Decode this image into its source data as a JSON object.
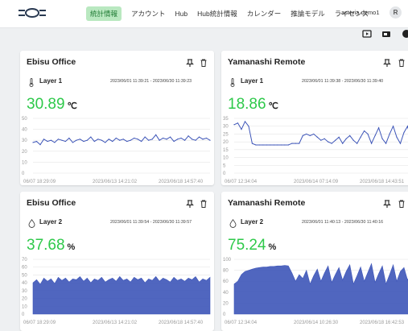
{
  "nav": {
    "items": [
      {
        "label": "統計情報",
        "active": true
      },
      {
        "label": "アカウント",
        "active": false
      },
      {
        "label": "Hub",
        "active": false
      },
      {
        "label": "Hub統計情報",
        "active": false
      },
      {
        "label": "カレンダー",
        "active": false
      },
      {
        "label": "推論モデル",
        "active": false
      },
      {
        "label": "ライセンス",
        "active": false
      }
    ],
    "user_name": "asteria demo1",
    "avatar_initial": "R"
  },
  "toolbar": {
    "icons": [
      "play-icon",
      "window-icon",
      "more-icon"
    ]
  },
  "colors": {
    "accent": "#2ec94a",
    "nav_active_bg": "#b9e8c0",
    "chart_line": "#3d55b8"
  },
  "cards": [
    {
      "title": "Ebisu Office",
      "sensor_icon": "thermometer-icon",
      "layer": "Layer 1",
      "range": "2023/06/01 11:39:21 - 2023/06/30 11:39:23",
      "value": "30.89",
      "unit": "℃",
      "chart_data": {
        "type": "line",
        "y_ticks": [
          "50",
          "40",
          "30",
          "20",
          "10",
          "0"
        ],
        "ylim": [
          0,
          50
        ],
        "x_ticks": [
          "06/07 18:29:09",
          "2023/06/13 14:21:02",
          "2023/06/18 14:57:40"
        ],
        "values": [
          28,
          29,
          26,
          31,
          29,
          30,
          28,
          31,
          30,
          29,
          32,
          28,
          30,
          31,
          29,
          30,
          33,
          29,
          31,
          30,
          28,
          31,
          29,
          32,
          30,
          31,
          29,
          30,
          32,
          31,
          29,
          33,
          30,
          31,
          35,
          30,
          32,
          31,
          33,
          29,
          31,
          32,
          30,
          34,
          31,
          30,
          33,
          31,
          32,
          30
        ]
      }
    },
    {
      "title": "Yamanashi Remote",
      "sensor_icon": "thermometer-icon",
      "layer": "Layer 1",
      "range": "2023/06/01 11:39:38 - 2023/06/30 11:39:40",
      "value": "18.86",
      "unit": "℃",
      "chart_data": {
        "type": "line",
        "y_ticks": [
          "35",
          "30",
          "25",
          "20",
          "15",
          "10",
          "5",
          "0"
        ],
        "ylim": [
          0,
          35
        ],
        "x_ticks": [
          "06/07 12:34:04",
          "2023/06/14 07:14:09",
          "2023/06/18 14:43:51"
        ],
        "values": [
          31,
          32,
          28,
          33,
          30,
          19,
          18,
          18,
          18,
          18,
          18,
          18,
          18,
          18,
          18,
          18,
          19,
          19,
          19,
          24,
          25,
          24,
          25,
          23,
          21,
          22,
          20,
          19,
          21,
          23,
          19,
          22,
          24,
          21,
          19,
          23,
          27,
          25,
          19,
          24,
          29,
          22,
          19,
          25,
          30,
          23,
          19,
          26,
          30,
          20
        ]
      }
    },
    {
      "title": "Ebisu Office",
      "sensor_icon": "droplet-icon",
      "layer": "Layer 2",
      "range": "2023/06/01 11:39:54 - 2023/06/30 11:39:57",
      "value": "37.68",
      "unit": "%",
      "chart_data": {
        "type": "area",
        "y_ticks": [
          "70",
          "60",
          "50",
          "40",
          "30",
          "20",
          "10",
          "0"
        ],
        "ylim": [
          0,
          70
        ],
        "x_ticks": [
          "06/07 18:29:09",
          "2023/06/13 14:21:02",
          "2023/06/18 14:57:40"
        ],
        "values": [
          40,
          44,
          38,
          46,
          42,
          45,
          39,
          47,
          43,
          46,
          41,
          45,
          44,
          48,
          42,
          46,
          40,
          45,
          43,
          47,
          41,
          44,
          46,
          42,
          48,
          43,
          45,
          41,
          47,
          44,
          46,
          40,
          45,
          43,
          48,
          42,
          46,
          44,
          41,
          47,
          43,
          45,
          42,
          46,
          44,
          48,
          41,
          45,
          43,
          47
        ]
      }
    },
    {
      "title": "Yamanashi Remote",
      "sensor_icon": "droplet-icon",
      "layer": "Layer 2",
      "range": "2023/06/01 11:40:13 - 2023/06/30 11:40:16",
      "value": "75.24",
      "unit": "%",
      "chart_data": {
        "type": "area",
        "y_ticks": [
          "100",
          "80",
          "60",
          "40",
          "20",
          "0"
        ],
        "ylim": [
          0,
          100
        ],
        "x_ticks": [
          "06/07 12:34:04",
          "2023/06/14 10:26:30",
          "2023/06/18 16:42:53"
        ],
        "values": [
          55,
          60,
          72,
          78,
          80,
          82,
          84,
          85,
          86,
          86,
          87,
          87,
          88,
          88,
          89,
          88,
          75,
          60,
          72,
          65,
          80,
          55,
          70,
          82,
          60,
          75,
          88,
          58,
          72,
          85,
          62,
          78,
          90,
          55,
          70,
          86,
          60,
          76,
          92,
          58,
          74,
          88,
          55,
          72,
          90,
          60,
          78,
          85,
          62,
          80
        ]
      }
    }
  ]
}
